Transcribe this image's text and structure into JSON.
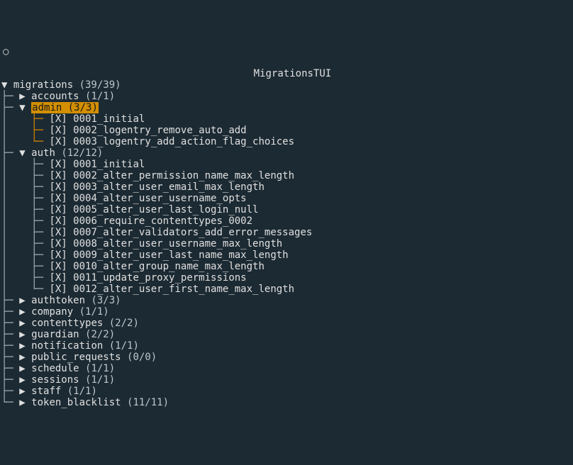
{
  "title": "MigrationsTUI",
  "root": {
    "label": "migrations",
    "count": "(39/39)"
  },
  "apps": [
    {
      "name": "accounts",
      "count": "(1/1)",
      "expanded": false,
      "selected": false,
      "migs": []
    },
    {
      "name": "admin",
      "count": "(3/3)",
      "expanded": true,
      "selected": true,
      "migs": [
        "[X] 0001_initial",
        "[X] 0002_logentry_remove_auto_add",
        "[X] 0003_logentry_add_action_flag_choices"
      ]
    },
    {
      "name": "auth",
      "count": "(12/12)",
      "expanded": true,
      "selected": false,
      "migs": [
        "[X] 0001_initial",
        "[X] 0002_alter_permission_name_max_length",
        "[X] 0003_alter_user_email_max_length",
        "[X] 0004_alter_user_username_opts",
        "[X] 0005_alter_user_last_login_null",
        "[X] 0006_require_contenttypes_0002",
        "[X] 0007_alter_validators_add_error_messages",
        "[X] 0008_alter_user_username_max_length",
        "[X] 0009_alter_user_last_name_max_length",
        "[X] 0010_alter_group_name_max_length",
        "[X] 0011_update_proxy_permissions",
        "[X] 0012_alter_user_first_name_max_length"
      ]
    },
    {
      "name": "authtoken",
      "count": "(3/3)",
      "expanded": false,
      "selected": false,
      "migs": []
    },
    {
      "name": "company",
      "count": "(1/1)",
      "expanded": false,
      "selected": false,
      "migs": []
    },
    {
      "name": "contenttypes",
      "count": "(2/2)",
      "expanded": false,
      "selected": false,
      "migs": []
    },
    {
      "name": "guardian",
      "count": "(2/2)",
      "expanded": false,
      "selected": false,
      "migs": []
    },
    {
      "name": "notification",
      "count": "(1/1)",
      "expanded": false,
      "selected": false,
      "migs": []
    },
    {
      "name": "public_requests",
      "count": "(0/0)",
      "expanded": false,
      "selected": false,
      "migs": []
    },
    {
      "name": "schedule",
      "count": "(1/1)",
      "expanded": false,
      "selected": false,
      "migs": []
    },
    {
      "name": "sessions",
      "count": "(1/1)",
      "expanded": false,
      "selected": false,
      "migs": []
    },
    {
      "name": "staff",
      "count": "(1/1)",
      "expanded": false,
      "selected": false,
      "migs": []
    },
    {
      "name": "token_blacklist",
      "count": "(11/11)",
      "expanded": false,
      "selected": false,
      "migs": []
    }
  ],
  "glyphs": {
    "caret_open": "▼",
    "caret_closed": "▶",
    "pipe": "│",
    "tee": "├─",
    "elbow": "└─",
    "circle": "○"
  }
}
